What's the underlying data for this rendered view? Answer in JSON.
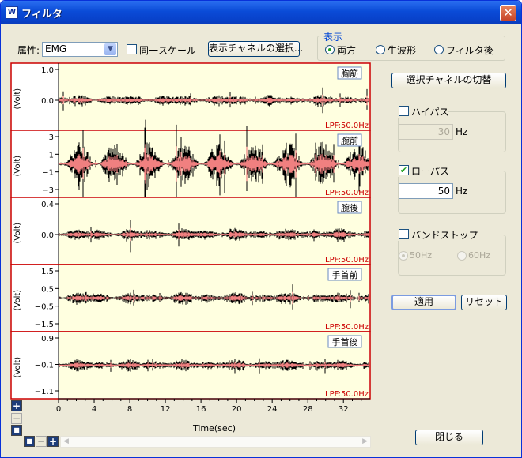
{
  "window": {
    "icon": "app-logo-icon",
    "title": "フィルタ",
    "close": "✕"
  },
  "toolbar": {
    "attribute_label": "属性:",
    "attribute_value": "EMG",
    "same_scale_label": "同一スケール",
    "same_scale_checked": false,
    "select_channels_button": "表示チャネルの選択..."
  },
  "display": {
    "title": "表示",
    "options": [
      "両方",
      "生波形",
      "フィルタ後"
    ],
    "selected": "両方"
  },
  "channels": [
    {
      "name": "胸筋",
      "ylabel": "(Volt)",
      "ticks": [
        "1.0",
        "0.0"
      ],
      "filter": "LPF:50.0Hz",
      "amp": 0.22,
      "bursty": false,
      "seed": 3
    },
    {
      "name": "腕前",
      "ylabel": "(Volt)",
      "ticks": [
        "3",
        "1",
        "−1",
        "−3"
      ],
      "filter": "LPF:50.0Hz",
      "amp": 0.9,
      "bursty": true,
      "seed": 7
    },
    {
      "name": "腕後",
      "ylabel": "(Volt)",
      "ticks": [
        "0.4",
        "0.0"
      ],
      "filter": "LPF:50.0Hz",
      "amp": 0.35,
      "bursty": false,
      "seed": 11
    },
    {
      "name": "手首前",
      "ylabel": "(Volt)",
      "ticks": [
        "1.5",
        "0.5",
        "−0.5",
        "−1.5"
      ],
      "filter": "LPF:50.0Hz",
      "amp": 0.3,
      "bursty": false,
      "seed": 17
    },
    {
      "name": "手首後",
      "ylabel": "(Volt)",
      "ticks": [
        "0.9",
        "−0.1",
        "−1.1"
      ],
      "filter": "LPF:50.0Hz",
      "amp": 0.3,
      "bursty": false,
      "seed": 23
    }
  ],
  "time_axis": {
    "ticks": [
      "0",
      "4",
      "8",
      "12",
      "16",
      "20",
      "24",
      "28",
      "32"
    ],
    "label": "Time(sec)"
  },
  "right_panel": {
    "switch_channel_button": "選択チャネルの切替",
    "highpass": {
      "label": "ハイパス",
      "checked": false,
      "value": "30",
      "unit": "Hz"
    },
    "lowpass": {
      "label": "ローパス",
      "checked": true,
      "value": "50",
      "unit": "Hz"
    },
    "bandstop": {
      "label": "バンドストップ",
      "checked": false,
      "options": [
        "50Hz",
        "60Hz"
      ],
      "selected": "50Hz"
    },
    "apply_button": "適用",
    "reset_button": "リセット",
    "close_button": "閉じる"
  },
  "zoom_controls": {
    "plus": "+",
    "minus": "−",
    "fit": "■"
  },
  "colors": {
    "raw": "#000000",
    "filtered": "#f08080",
    "plot_bg": "#ffffe0",
    "panel_border": "#cc0000",
    "filter_text": "#cc0000"
  }
}
